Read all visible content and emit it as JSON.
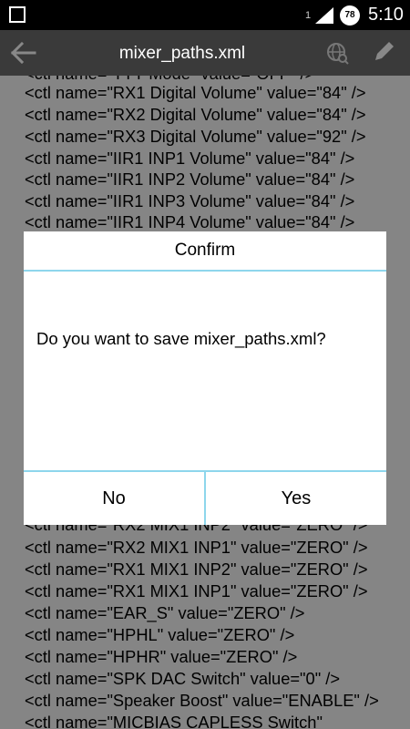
{
  "status_bar": {
    "sim_slot": "1",
    "battery": "78",
    "time": "5:10"
  },
  "action_bar": {
    "title": "mixer_paths.xml"
  },
  "editor": {
    "lines": [
      "<ctl name=\"TTY Mode\" value=\"OFF\" />",
      "<ctl name=\"RX1 Digital Volume\" value=\"84\" />",
      "<ctl name=\"RX2 Digital Volume\" value=\"84\" />",
      "<ctl name=\"RX3 Digital Volume\" value=\"92\" />",
      "<ctl name=\"IIR1 INP1 Volume\" value=\"84\" />",
      "<ctl name=\"IIR1 INP2 Volume\" value=\"84\" />",
      "<ctl name=\"IIR1 INP3 Volume\" value=\"84\" />",
      "<ctl name=\"IIR1 INP4 Volume\" value=\"84\" />",
      "<ctl name=\"RX2 MIX1 INP2\" value=\"ZERO\" />",
      "<ctl name=\"RX2 MIX1 INP1\" value=\"ZERO\" />",
      "<ctl name=\"RX1 MIX1 INP2\" value=\"ZERO\" />",
      "<ctl name=\"RX1 MIX1 INP1\" value=\"ZERO\" />",
      "<ctl name=\"EAR_S\" value=\"ZERO\" />",
      "<ctl name=\"HPHL\" value=\"ZERO\" />",
      "<ctl name=\"HPHR\" value=\"ZERO\" />",
      "<ctl name=\"SPK DAC Switch\" value=\"0\" />",
      "<ctl name=\"Speaker Boost\" value=\"ENABLE\" />",
      "<ctl name=\"MICBIAS CAPLESS Switch\""
    ]
  },
  "dialog": {
    "title": "Confirm",
    "message": "Do you want to save mixer_paths.xml?",
    "no_label": "No",
    "yes_label": "Yes"
  },
  "colors": {
    "accent": "#8ed6ec",
    "action_bar": "#3a3a3a",
    "status_bar": "#000000"
  },
  "icons": {
    "back": "arrow-left-icon",
    "web": "globe-search-icon",
    "edit": "pencil-icon"
  }
}
